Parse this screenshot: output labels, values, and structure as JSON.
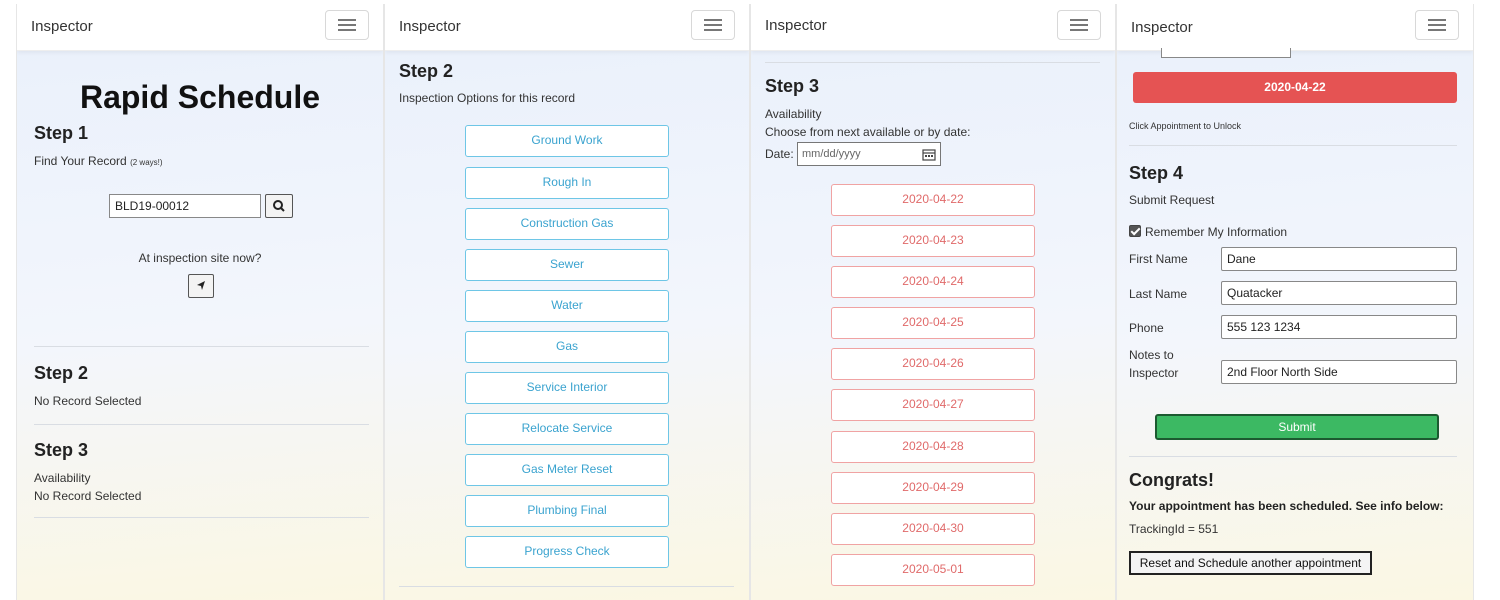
{
  "brand": "Inspector",
  "panel1": {
    "title": "Rapid Schedule",
    "step1": {
      "heading": "Step 1",
      "sub": "Find Your Record",
      "sub_hint": "(2 ways!)",
      "record_value": "BLD19-00012",
      "onsite": "At inspection site now?"
    },
    "step2": {
      "heading": "Step 2",
      "text": "No Record Selected"
    },
    "step3": {
      "heading": "Step 3",
      "sub": "Availability",
      "text": "No Record Selected"
    }
  },
  "panel2": {
    "heading": "Step 2",
    "sub": "Inspection Options for this record",
    "options": [
      "Ground Work",
      "Rough In",
      "Construction Gas",
      "Sewer",
      "Water",
      "Gas",
      "Service Interior",
      "Relocate Service",
      "Gas Meter Reset",
      "Plumbing Final",
      "Progress Check"
    ]
  },
  "panel3": {
    "heading": "Step 3",
    "sub": "Availability",
    "instruction": "Choose from next available or by date:",
    "date_label": "Date:",
    "date_placeholder": "mm/dd/yyyy",
    "dates": [
      "2020-04-22",
      "2020-04-23",
      "2020-04-24",
      "2020-04-25",
      "2020-04-26",
      "2020-04-27",
      "2020-04-28",
      "2020-04-29",
      "2020-04-30",
      "2020-05-01"
    ]
  },
  "panel4": {
    "selected_date": "2020-04-22",
    "unlock_hint": "Click Appointment to Unlock",
    "heading": "Step 4",
    "sub": "Submit Request",
    "remember_label": "Remember My Information",
    "remember_checked": true,
    "fields": {
      "first_name_label": "First Name",
      "first_name": "Dane",
      "last_name_label": "Last Name",
      "last_name": "Quatacker",
      "phone_label": "Phone",
      "phone": "555 123 1234",
      "notes_label_1": "Notes to",
      "notes_label_2": "Inspector",
      "notes": "2nd Floor North Side"
    },
    "submit": "Submit",
    "congrats": "Congrats!",
    "congrats_text": "Your appointment has been scheduled. See info below:",
    "tracking": "TrackingId = 551",
    "reset_button": "Reset and Schedule another appointment"
  },
  "colors": {
    "option_border": "#6ec6e6",
    "date_border": "#f0a3a3",
    "selected_date_bg": "#e55353",
    "submit_bg": "#3cb963"
  }
}
